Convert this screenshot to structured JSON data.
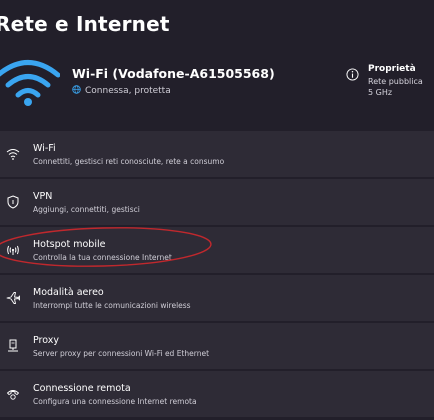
{
  "page": {
    "title": "Rete e Internet"
  },
  "hero": {
    "network_name": "Wi-Fi (Vodafone-A61505568)",
    "status": "Connessa, protetta",
    "properties": {
      "label": "Proprietà",
      "lines": [
        "Rete pubblica",
        "5 GHz"
      ]
    }
  },
  "items": [
    {
      "title": "Wi-Fi",
      "subtitle": "Connettiti, gestisci reti conosciute, rete a consumo",
      "icon": "wifi-icon"
    },
    {
      "title": "VPN",
      "subtitle": "Aggiungi, connettiti, gestisci",
      "icon": "shield-icon"
    },
    {
      "title": "Hotspot mobile",
      "subtitle": "Controlla la tua connessione Internet",
      "icon": "hotspot-icon"
    },
    {
      "title": "Modalità aereo",
      "subtitle": "Interrompi tutte le comunicazioni wireless",
      "icon": "airplane-icon"
    },
    {
      "title": "Proxy",
      "subtitle": "Server proxy per connessioni Wi-Fi ed Ethernet",
      "icon": "proxy-icon"
    },
    {
      "title": "Connessione remota",
      "subtitle": "Configura una connessione Internet remota",
      "icon": "dialup-icon"
    }
  ],
  "colors": {
    "accent": "#3aa5f0",
    "annotation": "#c0282d",
    "background": "#221f2a",
    "card": "#2e2b36"
  }
}
